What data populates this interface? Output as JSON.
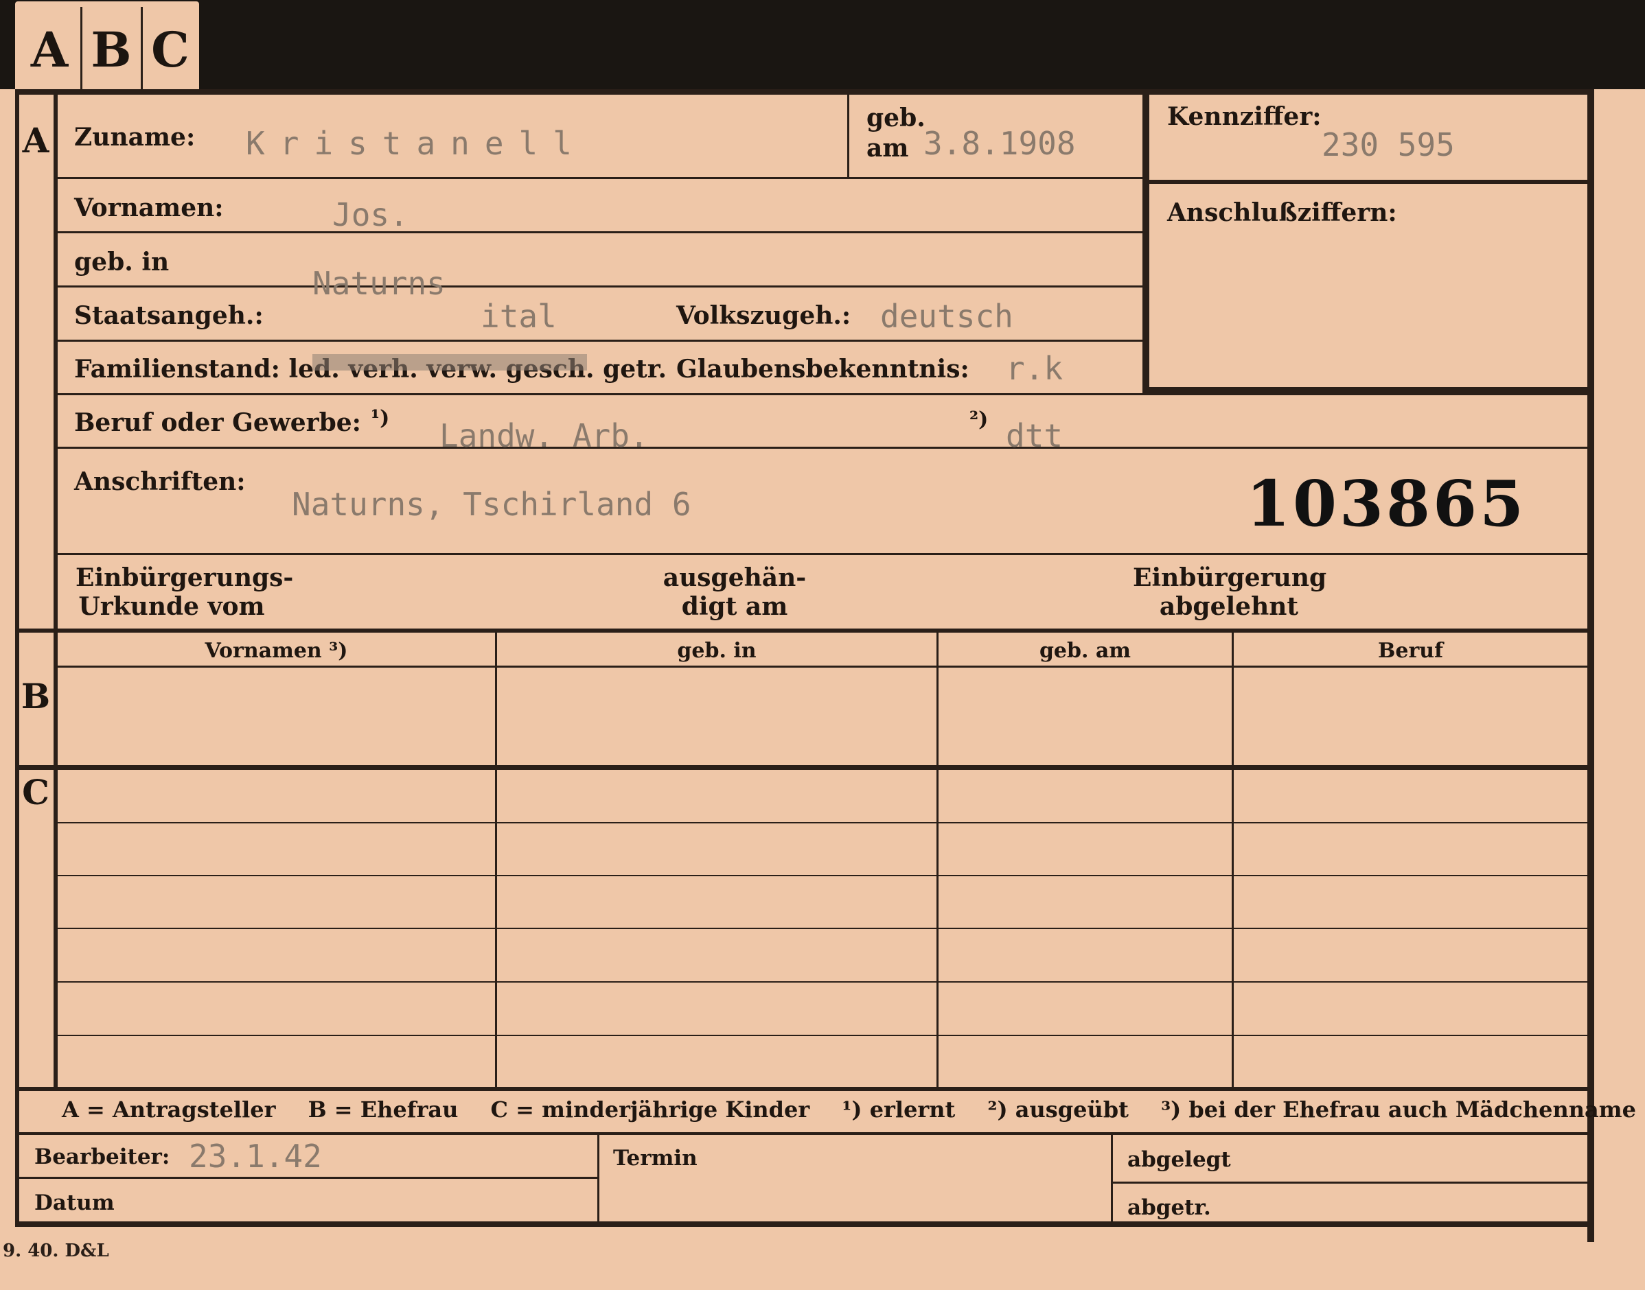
{
  "tabs": [
    "A",
    "B",
    "C"
  ],
  "section_A": {
    "marker": "A",
    "surname_label": "Zuname:",
    "surname_value": "Kristanell",
    "geb_label": "geb.",
    "am_label": "am",
    "birth_date": "3.8.1908",
    "kennziffer_label": "Kennziffer:",
    "kennziffer_value": "230 595",
    "anschluss_label": "Anschlußziffern:",
    "vornamen_label": "Vornamen:",
    "vornamen_value": "Jos.",
    "geb_in_label": "geb. in",
    "geb_in_value": "Naturns",
    "staatsangeh_label": "Staatsangeh.:",
    "staatsangeh_value": "ital",
    "volkszugeh_label": "Volkszugeh.:",
    "volkszugeh_value": "deutsch",
    "familienstand_label": "Familienstand: led. verh. verw. gesch. getr.",
    "glauben_label": "Glaubensbekenntnis:",
    "glauben_value": "r.k",
    "beruf_label": "Beruf oder Gewerbe:",
    "beruf_note1": "¹)",
    "beruf_value1": "Landw. Arb.",
    "beruf_note2": "²)",
    "beruf_value2": "dtt",
    "anschriften_label": "Anschriften:",
    "anschriften_value": "Naturns, Tschirland 6",
    "card_number": "103865",
    "einb_urkunde_l1": "Einbürgerungs-",
    "einb_urkunde_l2": "Urkunde vom",
    "ausgeh_l1": "ausgehän-",
    "ausgeh_l2": "digt am",
    "einb_abgelehnt_l1": "Einbürgerung",
    "einb_abgelehnt_l2": "abgelehnt"
  },
  "section_B": {
    "marker": "B",
    "columns": [
      "Vornamen ³)",
      "geb. in",
      "geb. am",
      "Beruf"
    ]
  },
  "section_C": {
    "marker": "C"
  },
  "legend": [
    "A = Antragsteller",
    "B = Ehefrau",
    "C = minderjährige Kinder",
    "¹) erlernt",
    "²) ausgeübt",
    "³) bei der Ehefrau auch Mädchenname"
  ],
  "footer": {
    "bearbeiter_label": "Bearbeiter:",
    "bearbeiter_value": "23.1.42",
    "datum_label": "Datum",
    "termin_label": "Termin",
    "abgelegt_label": "abgelegt",
    "abgetr_label": "abgetr."
  },
  "print_code": "9. 40. D&L"
}
